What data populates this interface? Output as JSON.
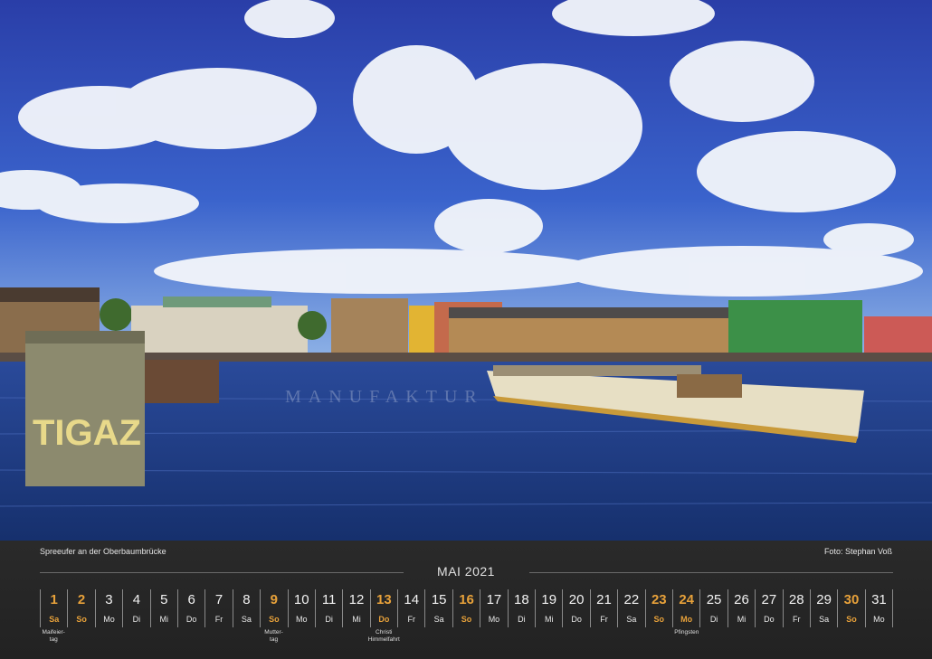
{
  "caption_left": "Spreeufer an der Oberbaumbrücke",
  "caption_right": "Foto: Stephan Voß",
  "month_title": "MAI 2021",
  "photo": {
    "graffiti_text": "TIGAZ",
    "watermark": "MANUFAKTUR"
  },
  "colors": {
    "highlight": "#e7a13a",
    "band": "#262626",
    "sky": "#2b46b5",
    "water": "#1d3c86"
  },
  "days": [
    {
      "num": "1",
      "wd": "Sa",
      "hl": true
    },
    {
      "num": "2",
      "wd": "So",
      "hl": true
    },
    {
      "num": "3",
      "wd": "Mo",
      "hl": false
    },
    {
      "num": "4",
      "wd": "Di",
      "hl": false
    },
    {
      "num": "5",
      "wd": "Mi",
      "hl": false
    },
    {
      "num": "6",
      "wd": "Do",
      "hl": false
    },
    {
      "num": "7",
      "wd": "Fr",
      "hl": false
    },
    {
      "num": "8",
      "wd": "Sa",
      "hl": false
    },
    {
      "num": "9",
      "wd": "So",
      "hl": true
    },
    {
      "num": "10",
      "wd": "Mo",
      "hl": false
    },
    {
      "num": "11",
      "wd": "Di",
      "hl": false
    },
    {
      "num": "12",
      "wd": "Mi",
      "hl": false
    },
    {
      "num": "13",
      "wd": "Do",
      "hl": true
    },
    {
      "num": "14",
      "wd": "Fr",
      "hl": false
    },
    {
      "num": "15",
      "wd": "Sa",
      "hl": false
    },
    {
      "num": "16",
      "wd": "So",
      "hl": true
    },
    {
      "num": "17",
      "wd": "Mo",
      "hl": false
    },
    {
      "num": "18",
      "wd": "Di",
      "hl": false
    },
    {
      "num": "19",
      "wd": "Mi",
      "hl": false
    },
    {
      "num": "20",
      "wd": "Do",
      "hl": false
    },
    {
      "num": "21",
      "wd": "Fr",
      "hl": false
    },
    {
      "num": "22",
      "wd": "Sa",
      "hl": false
    },
    {
      "num": "23",
      "wd": "So",
      "hl": true
    },
    {
      "num": "24",
      "wd": "Mo",
      "hl": true
    },
    {
      "num": "25",
      "wd": "Di",
      "hl": false
    },
    {
      "num": "26",
      "wd": "Mi",
      "hl": false
    },
    {
      "num": "27",
      "wd": "Do",
      "hl": false
    },
    {
      "num": "28",
      "wd": "Fr",
      "hl": false
    },
    {
      "num": "29",
      "wd": "Sa",
      "hl": false
    },
    {
      "num": "30",
      "wd": "So",
      "hl": true
    },
    {
      "num": "31",
      "wd": "Mo",
      "hl": false
    }
  ],
  "holidays": [
    {
      "day": 1,
      "line1": "Maifeier-",
      "line2": "tag"
    },
    {
      "day": 9,
      "line1": "Mutter-",
      "line2": "tag"
    },
    {
      "day": 13,
      "line1": "Christi",
      "line2": "Himmelfahrt"
    },
    {
      "day": 24,
      "line1": "Pfingsten",
      "line2": ""
    }
  ]
}
